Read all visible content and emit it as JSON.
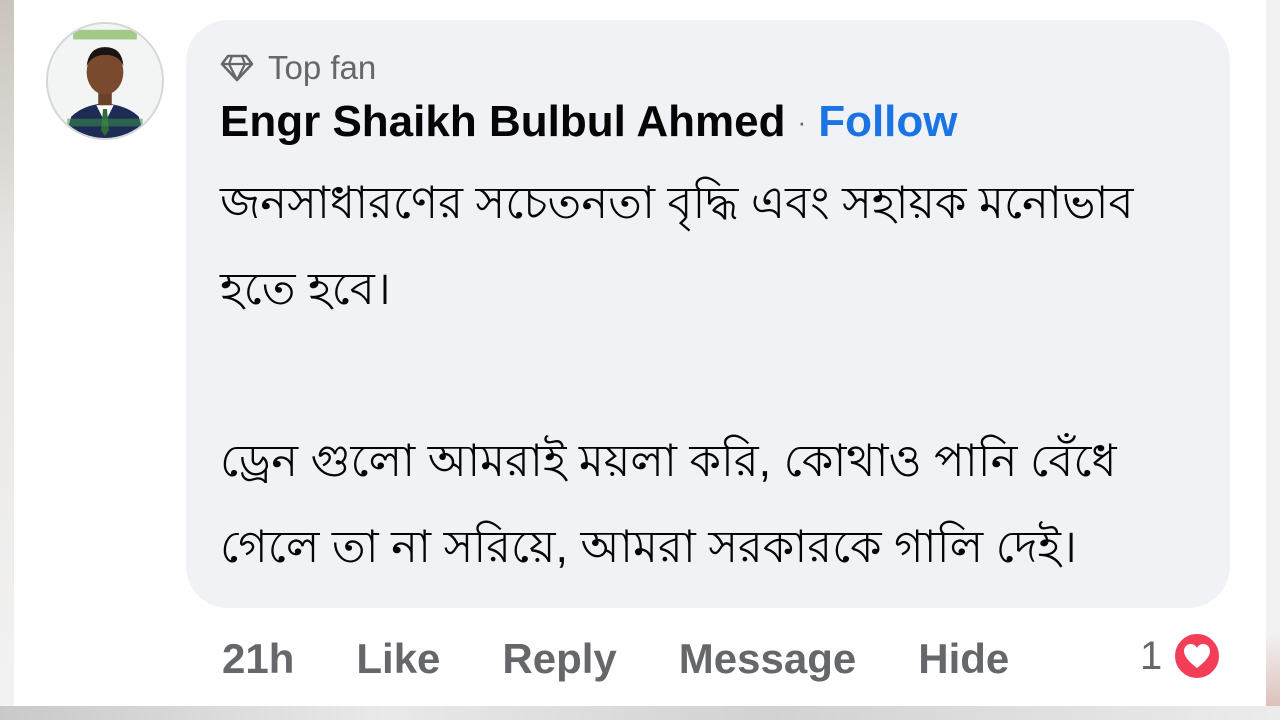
{
  "comment": {
    "badge": {
      "icon": "diamond-icon",
      "label": "Top fan"
    },
    "author": "Engr Shaikh Bulbul Ahmed",
    "separator": "·",
    "follow_label": "Follow",
    "paragraphs": [
      "জনসাধারণের সচেতনতা বৃদ্ধি এবং সহায়ক মনোভাব হতে হবে।",
      "ড্রেন গুলো আমরাই ময়লা করি, কোথাও পানি বেঁধে গেলে তা না সরিয়ে, আমরা সরকারকে গালি দেই।"
    ],
    "actions": {
      "time": "21h",
      "like": "Like",
      "reply": "Reply",
      "message": "Message",
      "hide": "Hide"
    },
    "reactions": {
      "count": "1",
      "icon": "heart-icon",
      "color": "#f33e58"
    }
  },
  "colors": {
    "bubble": "#f0f2f5",
    "follow": "#1b74e4",
    "secondary_text": "#65676b",
    "primary_text": "#050505"
  }
}
